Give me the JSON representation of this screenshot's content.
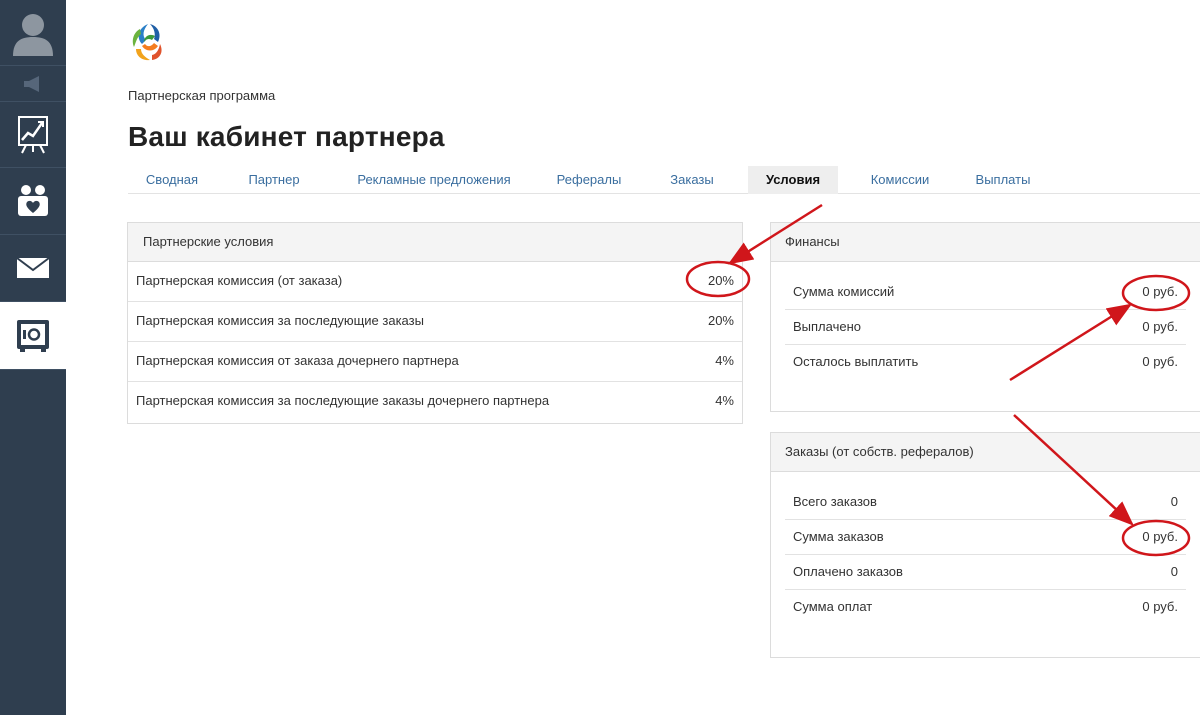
{
  "sidebar": {
    "items": [
      {
        "icon": "user-avatar-icon"
      },
      {
        "icon": "megaphone-icon"
      },
      {
        "icon": "chart-board-icon"
      },
      {
        "icon": "partners-icon"
      },
      {
        "icon": "mail-icon"
      },
      {
        "icon": "safe-icon",
        "active": true
      }
    ]
  },
  "logo": {
    "icon": "company-logo"
  },
  "breadcrumb": "Партнерская программа",
  "page_title": "Ваш кабинет партнера",
  "tabs": [
    {
      "label": "Сводная"
    },
    {
      "label": "Партнер"
    },
    {
      "label": "Рекламные предложения"
    },
    {
      "label": "Рефералы"
    },
    {
      "label": "Заказы"
    },
    {
      "label": "Условия",
      "active": true
    },
    {
      "label": "Комиссии"
    },
    {
      "label": "Выплаты"
    }
  ],
  "conditions": {
    "title": "Партнерские условия",
    "rows": [
      {
        "label": "Партнерская комиссия (от заказа)",
        "value": "20%"
      },
      {
        "label": "Партнерская комиссия за последующие заказы",
        "value": "20%"
      },
      {
        "label": "Партнерская комиссия от заказа дочернего партнера",
        "value": "4%"
      },
      {
        "label": "Партнерская комиссия за последующие заказы дочернего партнера",
        "value": "4%"
      }
    ]
  },
  "finances": {
    "title": "Финансы",
    "rows": [
      {
        "label": "Сумма комиссий",
        "value": "0 руб."
      },
      {
        "label": "Выплачено",
        "value": "0 руб."
      },
      {
        "label": "Осталось выплатить",
        "value": "0 руб."
      }
    ]
  },
  "orders": {
    "title": "Заказы (от собств. рефералов)",
    "rows": [
      {
        "label": "Всего заказов",
        "value": "0"
      },
      {
        "label": "Сумма заказов",
        "value": "0 руб."
      },
      {
        "label": "Оплачено заказов",
        "value": "0"
      },
      {
        "label": "Сумма оплат",
        "value": "0 руб."
      }
    ]
  },
  "colors": {
    "sidebar_bg": "#2f3e4f",
    "tab_link": "#3a6e9f",
    "annotation_red": "#d0161b"
  }
}
